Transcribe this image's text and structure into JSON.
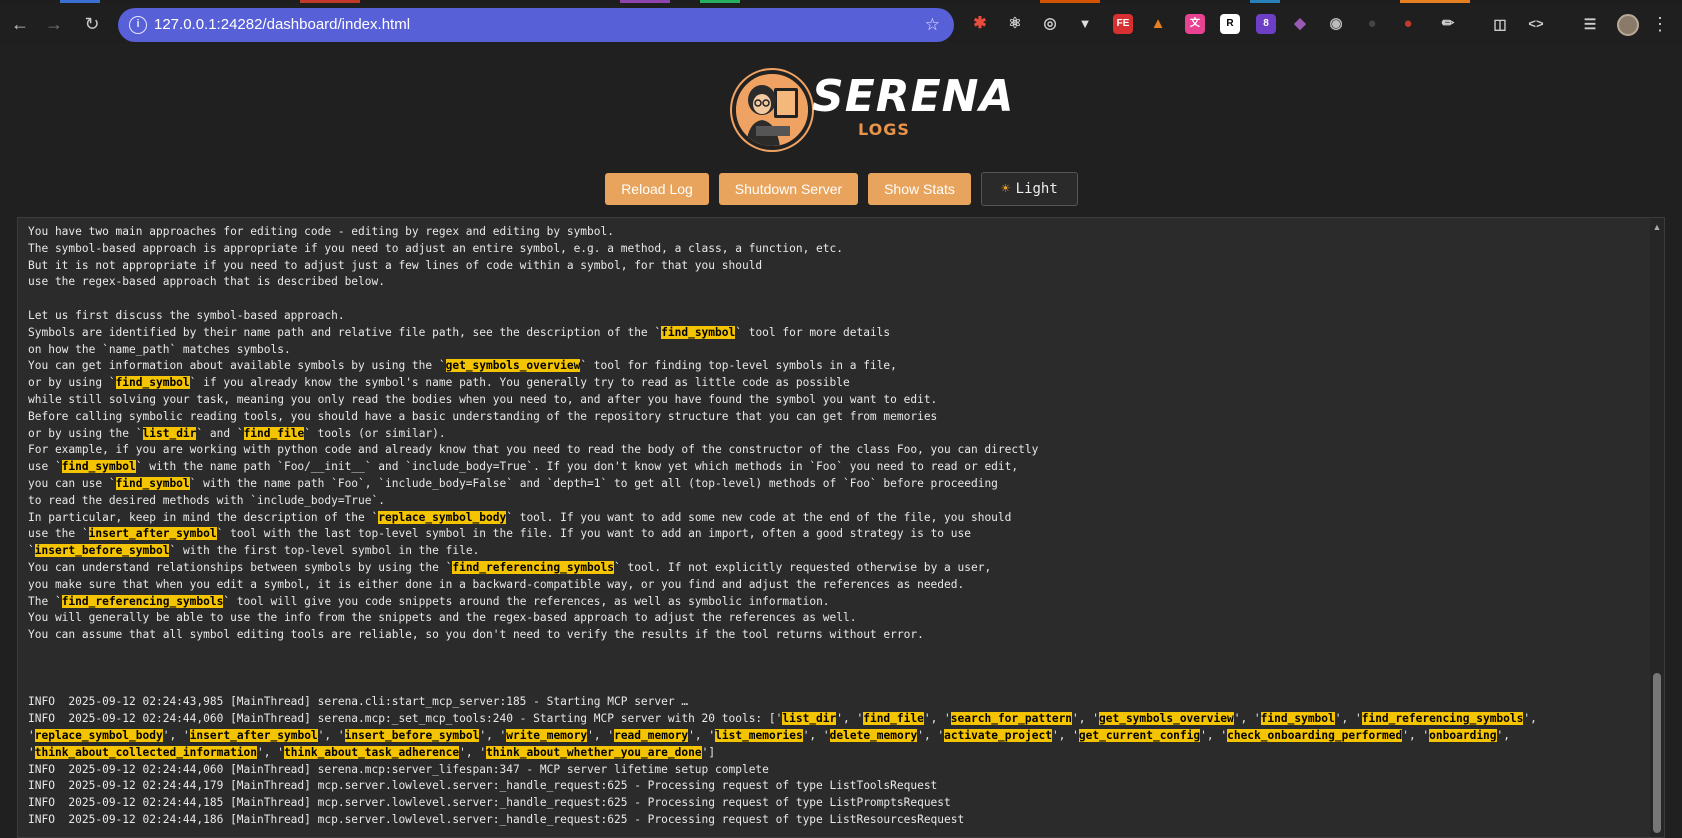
{
  "browser": {
    "url": "127.0.0.1:24282/dashboard/index.html",
    "extension_badge": "8"
  },
  "header": {
    "logo_title": "SERENA",
    "logo_subtitle": "LOGS"
  },
  "controls": {
    "reload_label": "Reload Log",
    "shutdown_label": "Shutdown Server",
    "stats_label": "Show Stats",
    "theme_label": "Light",
    "theme_icon": "sun-icon"
  },
  "colors": {
    "accent_button": "#e8a35c",
    "highlight": "#f5c400",
    "background": "#202020",
    "log_background": "#2b2b2b"
  },
  "log_lines": [
    "You have two main approaches for editing code - editing by regex and editing by symbol.",
    "The symbol-based approach is appropriate if you need to adjust an entire symbol, e.g. a method, a class, a function, etc.",
    "But it is not appropriate if you need to adjust just a few lines of code within a symbol, for that you should",
    "use the regex-based approach that is described below.",
    "",
    "Let us first discuss the symbol-based approach.",
    "Symbols are identified by their name path and relative file path, see the description of the `[[find_symbol]]` tool for more details",
    "on how the `name_path` matches symbols.",
    "You can get information about available symbols by using the `[[get_symbols_overview]]` tool for finding top-level symbols in a file,",
    "or by using `[[find_symbol]]` if you already know the symbol's name path. You generally try to read as little code as possible",
    "while still solving your task, meaning you only read the bodies when you need to, and after you have found the symbol you want to edit.",
    "Before calling symbolic reading tools, you should have a basic understanding of the repository structure that you can get from memories",
    "or by using the `[[list_dir]]` and `[[find_file]]` tools (or similar).",
    "For example, if you are working with python code and already know that you need to read the body of the constructor of the class Foo, you can directly",
    "use `[[find_symbol]]` with the name path `Foo/__init__` and `include_body=True`. If you don't know yet which methods in `Foo` you need to read or edit,",
    "you can use `[[find_symbol]]` with the name path `Foo`, `include_body=False` and `depth=1` to get all (top-level) methods of `Foo` before proceeding",
    "to read the desired methods with `include_body=True`.",
    "In particular, keep in mind the description of the `[[replace_symbol_body]]` tool. If you want to add some new code at the end of the file, you should",
    "use the `[[insert_after_symbol]]` tool with the last top-level symbol in the file. If you want to add an import, often a good strategy is to use",
    "`[[insert_before_symbol]]` with the first top-level symbol in the file.",
    "You can understand relationships between symbols by using the `[[find_referencing_symbols]]` tool. If not explicitly requested otherwise by a user,",
    "you make sure that when you edit a symbol, it is either done in a backward-compatible way, or you find and adjust the references as needed.",
    "The `[[find_referencing_symbols]]` tool will give you code snippets around the references, as well as symbolic information.",
    "You will generally be able to use the info from the snippets and the regex-based approach to adjust the references as well.",
    "You can assume that all symbol editing tools are reliable, so you don't need to verify the results if the tool returns without error.",
    "",
    "",
    "",
    "INFO  2025-09-12 02:24:43,985 [MainThread] serena.cli:start_mcp_server:185 - Starting MCP server …",
    "INFO  2025-09-12 02:24:44,060 [MainThread] serena.mcp:_set_mcp_tools:240 - Starting MCP server with 20 tools: ['[[list_dir]]', '[[find_file]]', '[[search_for_pattern]]', '[[get_symbols_overview]]', '[[find_symbol]]', '[[find_referencing_symbols]]',",
    "'[[replace_symbol_body]]', '[[insert_after_symbol]]', '[[insert_before_symbol]]', '[[write_memory]]', '[[read_memory]]', '[[list_memories]]', '[[delete_memory]]', '[[activate_project]]', '[[get_current_config]]', '[[check_onboarding_performed]]', '[[onboarding]]',",
    "'[[think_about_collected_information]]', '[[think_about_task_adherence]]', '[[think_about_whether_you_are_done]]']",
    "INFO  2025-09-12 02:24:44,060 [MainThread] serena.mcp:server_lifespan:347 - MCP server lifetime setup complete",
    "INFO  2025-09-12 02:24:44,179 [MainThread] mcp.server.lowlevel.server:_handle_request:625 - Processing request of type ListToolsRequest",
    "INFO  2025-09-12 02:24:44,185 [MainThread] mcp.server.lowlevel.server:_handle_request:625 - Processing request of type ListPromptsRequest",
    "INFO  2025-09-12 02:24:44,186 [MainThread] mcp.server.lowlevel.server:_handle_request:625 - Processing request of type ListResourcesRequest"
  ]
}
